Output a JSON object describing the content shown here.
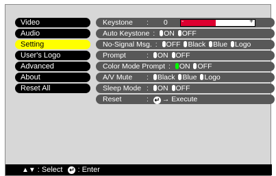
{
  "menu": [
    {
      "label": "Video",
      "selected": false
    },
    {
      "label": "Audio",
      "selected": false
    },
    {
      "label": "Setting",
      "selected": true
    },
    {
      "label": "User's Logo",
      "selected": false
    },
    {
      "label": "Advanced",
      "selected": false
    },
    {
      "label": "About",
      "selected": false
    },
    {
      "label": "Reset All",
      "selected": false
    }
  ],
  "settings": {
    "keystone": {
      "label": "Keystone",
      "value": "0",
      "minus": "-",
      "plus": "+",
      "level": 0.47
    },
    "auto_keystone": {
      "label": "Auto Keystone",
      "on": "ON",
      "off": "OFF"
    },
    "no_signal": {
      "label": "No-Signal Msg.",
      "off": "OFF",
      "black": "Black",
      "blue": "Blue",
      "logo": "Logo"
    },
    "prompt": {
      "label": "Prompt",
      "on": "ON",
      "off": "OFF"
    },
    "color_mode_prompt": {
      "label": "Color Mode Prompt",
      "on": "ON",
      "off": "OFF"
    },
    "av_mute": {
      "label": "A/V Mute",
      "black": "Black",
      "blue": "Blue",
      "logo": "Logo"
    },
    "sleep_mode": {
      "label": "Sleep Mode",
      "on": "ON",
      "off": "OFF"
    },
    "reset": {
      "label": "Reset",
      "action": "Execute"
    }
  },
  "footer": {
    "select_label": ": Select",
    "enter_label": ": Enter"
  },
  "colors": {
    "background": "#d7d7d7",
    "menu_bg": "#000000",
    "menu_selected": "#ffff00",
    "row_bg": "#585858",
    "slider_fill": "#dd0030",
    "active_dot": "#00ff00"
  }
}
